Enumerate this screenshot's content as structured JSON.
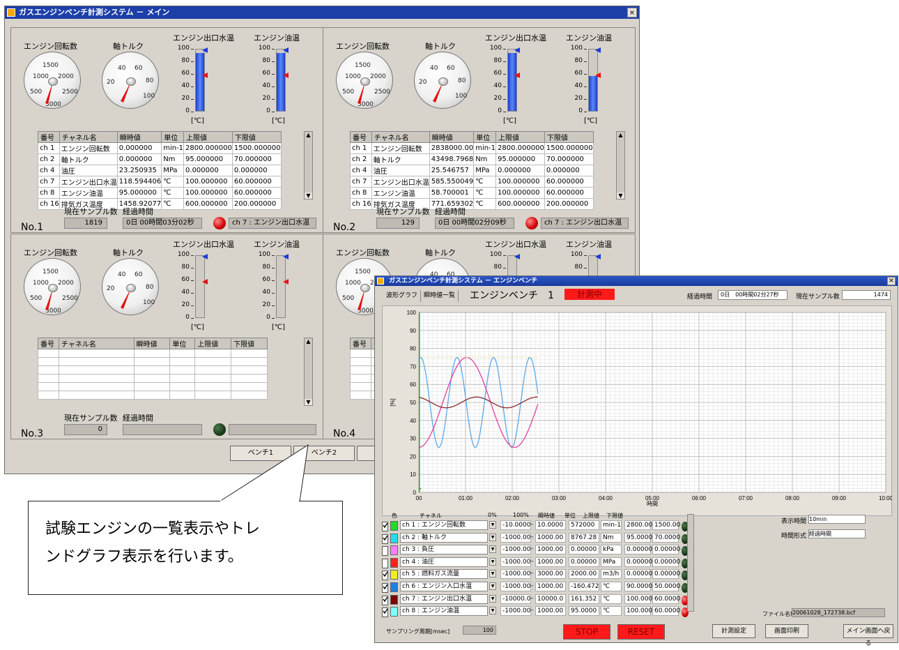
{
  "main_window": {
    "title": "ガスエンジンベンチ計測システム － メイン",
    "close": "×",
    "panels": [
      {
        "id": "No.1",
        "gauge1_label": "エンジン回転数",
        "gauge2_label": "軸トルク",
        "tank1_label": "エンジン出口水温",
        "tank2_label": "エンジン油温",
        "rpm_dial": [
          "500",
          "1000",
          "1500",
          "2000",
          "2500",
          "3000",
          "0"
        ],
        "torque_dial": [
          "20",
          "40",
          "60",
          "80",
          "100",
          "0"
        ],
        "tank_ticks": [
          "100",
          "80",
          "60",
          "40",
          "20",
          "0"
        ],
        "unit": "[℃]",
        "tank1_level": 0.92,
        "tank2_level": 0.92,
        "table": {
          "headers": [
            "番号",
            "チャネル名",
            "瞬時値",
            "単位",
            "上限値",
            "下限値"
          ],
          "rows": [
            [
              "ch 1",
              "エンジン回転数",
              "0.000000",
              "min-1",
              "2800.000000",
              "1500.000000"
            ],
            [
              "ch 2",
              "軸トルク",
              "0.000000",
              "Nm",
              "95.000000",
              "70.000000"
            ],
            [
              "ch 4",
              "油圧",
              "23.250935",
              "MPa",
              "0.000000",
              "0.000000"
            ],
            [
              "ch 7",
              "エンジン出口水温",
              "118.594406",
              "℃",
              "100.000000",
              "60.000000"
            ],
            [
              "ch 8",
              "エンジン油温",
              "95.000000",
              "℃",
              "100.000000",
              "60.000000"
            ],
            [
              "ch 16",
              "排気ガス温度",
              "1458.92077",
              "℃",
              "600.000000",
              "200.000000"
            ]
          ]
        },
        "samples_label": "現在サンプル数",
        "elapsed_label": "経過時間",
        "samples": "1819",
        "elapsed": "0日  00時間03分02秒",
        "alarm": "ch 7 : エンジン出口水温",
        "led": "red"
      },
      {
        "id": "No.2",
        "gauge1_label": "エンジン回転数",
        "gauge2_label": "軸トルク",
        "tank1_label": "エンジン出口水温",
        "tank2_label": "エンジン油温",
        "rpm_dial": [
          "500",
          "1000",
          "1500",
          "2000",
          "2500",
          "3000",
          "0"
        ],
        "torque_dial": [
          "20",
          "40",
          "60",
          "80",
          "100",
          "0"
        ],
        "tank_ticks": [
          "100",
          "80",
          "60",
          "40",
          "20",
          "0"
        ],
        "unit": "[℃]",
        "tank1_level": 0.92,
        "tank2_level": 0.55,
        "table": {
          "headers": [
            "番号",
            "チャネル名",
            "瞬時値",
            "単位",
            "上限値",
            "下限値"
          ],
          "rows": [
            [
              "ch 1",
              "エンジン回転数",
              "2838000.00",
              "min-1",
              "2800.000000",
              "1500.000000"
            ],
            [
              "ch 2",
              "軸トルク",
              "43498.7968",
              "Nm",
              "95.000000",
              "70.000000"
            ],
            [
              "ch 4",
              "油圧",
              "25.546757",
              "MPa",
              "0.000000",
              "0.000000"
            ],
            [
              "ch 7",
              "エンジン出口水温",
              "585.550049",
              "℃",
              "100.000000",
              "60.000000"
            ],
            [
              "ch 8",
              "エンジン油温",
              "58.700001",
              "℃",
              "100.000000",
              "60.000000"
            ],
            [
              "ch 16",
              "排気ガス温度",
              "771.659302",
              "℃",
              "600.000000",
              "200.000000"
            ]
          ]
        },
        "samples_label": "現在サンプル数",
        "elapsed_label": "経過時間",
        "samples": "129",
        "elapsed": "0日  00時間02分09秒",
        "alarm": "ch 7 : エンジン出口水温",
        "led": "red"
      },
      {
        "id": "No.3",
        "gauge1_label": "エンジン回転数",
        "gauge2_label": "軸トルク",
        "tank1_label": "エンジン出口水温",
        "tank2_label": "エンジン油温",
        "rpm_dial": [
          "500",
          "1000",
          "1500",
          "2000",
          "2500",
          "3000",
          "0"
        ],
        "torque_dial": [
          "20",
          "40",
          "60",
          "80",
          "100",
          "0"
        ],
        "tank_ticks": [
          "100",
          "80",
          "60",
          "40",
          "20",
          "0"
        ],
        "unit": "[℃]",
        "tank1_level": 0,
        "tank2_level": 0,
        "table": {
          "headers": [
            "番号",
            "チャネル名",
            "瞬時値",
            "単位",
            "上限値",
            "下限値"
          ],
          "rows": []
        },
        "samples_label": "現在サンプル数",
        "elapsed_label": "経過時間",
        "samples": "0",
        "elapsed": "",
        "alarm": "",
        "led": "grn"
      },
      {
        "id": "No.4",
        "gauge1_label": "エンジン回転数",
        "gauge2_label": "軸トルク",
        "tank1_label": "エンジン出口水温",
        "tank2_label": "エンジン油温",
        "rpm_dial": [
          "500",
          "1000",
          "1500",
          "2000",
          "2500",
          "3000",
          "0"
        ],
        "torque_dial": [
          "20",
          "40",
          "60",
          "80",
          "100",
          "0"
        ],
        "tank_ticks": [
          "100",
          "80",
          "60",
          "40",
          "20",
          "0"
        ],
        "unit": "[℃]",
        "tank1_level": 0,
        "tank2_level": 0,
        "table": {
          "headers": [
            "番号",
            "チ"
          ],
          "rows": []
        },
        "samples_label": "現",
        "elapsed_label": "",
        "samples": "",
        "elapsed": "",
        "alarm": "",
        "led": "grn"
      }
    ],
    "buttons": [
      "ベンチ1",
      "ベンチ2"
    ]
  },
  "callout": {
    "line1": "試験エンジンの一覧表示やトレ",
    "line2": "ンドグラフ表示を行います。"
  },
  "bench_window": {
    "title": "ガスエンジンベンチ計測システム － エンジンベンチ",
    "close": "×",
    "tabs": [
      "波形グラフ",
      "瞬時値一覧"
    ],
    "heading": "エンジンベンチ　1",
    "status": "計測中",
    "elapsed_label": "経過時間",
    "elapsed": "0日　00時間02分27秒",
    "samples_label": "現在サンプル数",
    "samples": "1474",
    "ylabel": "[%]",
    "xlabel": "時間",
    "channel_headers": [
      "色",
      "チャネル",
      "0%",
      "100%",
      "瞬時値",
      "単位",
      "上限値",
      "下限値"
    ],
    "channels": [
      {
        "checked": true,
        "color": "#2ad82a",
        "name": "ch 1 : エンジン回転数",
        "min": "-10.0000",
        "max": "10.0000",
        "value": "572000",
        "unit": "min-1",
        "hi": "2800.00",
        "lo": "1500.00",
        "led": "grn"
      },
      {
        "checked": true,
        "color": "#20e0f0",
        "name": "ch 2 : 軸トルク",
        "min": "-1000.00",
        "max": "1000.00",
        "value": "8767.28",
        "unit": "Nm",
        "hi": "95.0000",
        "lo": "70.0000",
        "led": "grn"
      },
      {
        "checked": false,
        "color": "#ff80ff",
        "name": "ch 3 : 負圧",
        "min": "-1000.00",
        "max": "1000.00",
        "value": "0.00000",
        "unit": "kPa",
        "hi": "0.00000",
        "lo": "0.00000",
        "led": "grn"
      },
      {
        "checked": false,
        "color": "#ff2020",
        "name": "ch 4 : 油圧",
        "min": "-1000.00",
        "max": "1000.00",
        "value": "0.00000",
        "unit": "MPa",
        "hi": "0.00000",
        "lo": "0.00000",
        "led": "grn"
      },
      {
        "checked": true,
        "color": "#f0f020",
        "name": "ch 5 : 燃料ガス流量",
        "min": "-1000.00",
        "max": "3000.00",
        "value": "2000.00",
        "unit": "m3/h",
        "hi": "0.00000",
        "lo": "0.00000",
        "led": "grn"
      },
      {
        "checked": true,
        "color": "#2080e0",
        "name": "ch 6 : エンジン入口水温",
        "min": "-1000.00",
        "max": "1000.00",
        "value": "-160.472",
        "unit": "℃",
        "hi": "90.0000",
        "lo": "50.0000",
        "led": "grn"
      },
      {
        "checked": true,
        "color": "#800000",
        "name": "ch 7 : エンジン出口水温",
        "min": "-10000.0",
        "max": "10000.0",
        "value": "161.352",
        "unit": "℃",
        "hi": "100.000",
        "lo": "60.0000",
        "led": "red"
      },
      {
        "checked": true,
        "color": "#80ffff",
        "name": "ch 8 : エンジン油温",
        "min": "-1000.00",
        "max": "1000.00",
        "value": "95.0000",
        "unit": "℃",
        "hi": "100.000",
        "lo": "60.0000",
        "led": "red"
      }
    ],
    "display_time_label": "表示時間",
    "display_time": "10min",
    "time_format_label": "時間形式",
    "time_format": "経過時間",
    "filename_label": "ファイル名称",
    "filename": "20061028_172738.bcf",
    "sampling_label": "サンプリング周期[msec]",
    "sampling": "100",
    "stop": "STOP",
    "reset": "RESET",
    "settings": "計測設定",
    "print": "画面印刷",
    "back": "メイン画面へ戻る"
  },
  "chart_data": {
    "type": "line",
    "ylabel": "[%]",
    "xlabel": "時間",
    "ylim": [
      0,
      100
    ],
    "xlim": [
      0,
      10
    ],
    "x_ticks": [
      "00",
      "01:00",
      "02:00",
      "03:00",
      "04:00",
      "05:00\n時間",
      "06:00",
      "07:00",
      "08:00",
      "09:00",
      "10:00"
    ],
    "y_ticks": [
      "0",
      "10",
      "20",
      "30",
      "40",
      "50",
      "60",
      "70",
      "80",
      "90",
      "100"
    ],
    "grid": true,
    "series": [
      {
        "color": "#5aa8e8",
        "amp": 25,
        "mid": 50,
        "period": 0.78,
        "phase": 0.2,
        "x_end": 2.55
      },
      {
        "color": "#e040a0",
        "amp": 25,
        "mid": 50,
        "period": 2.05,
        "phase": -0.25,
        "x_end": 2.55
      },
      {
        "color": "#8a2a2a",
        "amp": 3,
        "mid": 50,
        "period": 1.3,
        "phase": 0.3,
        "x_end": 2.55
      },
      {
        "color": "#e0e0a0",
        "amp": 0,
        "mid": 75,
        "period": 1,
        "phase": 0,
        "x_end": 2.55
      },
      {
        "color": "#1aa01a",
        "amp": 0,
        "mid": 2,
        "period": 1,
        "phase": 0,
        "x_end": 0.05
      }
    ]
  }
}
